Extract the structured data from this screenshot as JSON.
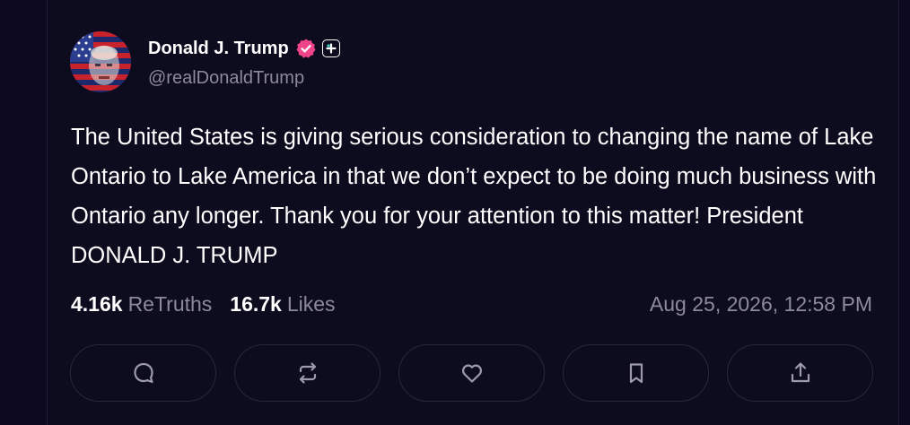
{
  "post": {
    "author_name": "Donald J. Trump",
    "handle": "@realDonaldTrump",
    "text": "The United States is giving serious consideration to changing the name of Lake Ontario to Lake America in that we don’t expect to be doing much business with Ontario any longer. Thank you for your attention to this matter! President DONALD J. TRUMP",
    "retruths_count": "4.16k",
    "retruths_label": "ReTruths",
    "likes_count": "16.7k",
    "likes_label": "Likes",
    "timestamp": "Aug 25, 2026, 12:58 PM"
  },
  "badges": {
    "verified_icon": "verified-badge-icon",
    "plus_icon": "plus-badge-icon"
  },
  "actions": [
    {
      "icon": "reply-icon"
    },
    {
      "icon": "retruth-icon"
    },
    {
      "icon": "heart-icon"
    },
    {
      "icon": "bookmark-icon"
    },
    {
      "icon": "share-icon"
    }
  ],
  "colors": {
    "background": "#0d0b1e",
    "text": "#ffffff",
    "muted": "#8e8a9e",
    "verified": "#f0448a",
    "border": "#2a2641"
  }
}
